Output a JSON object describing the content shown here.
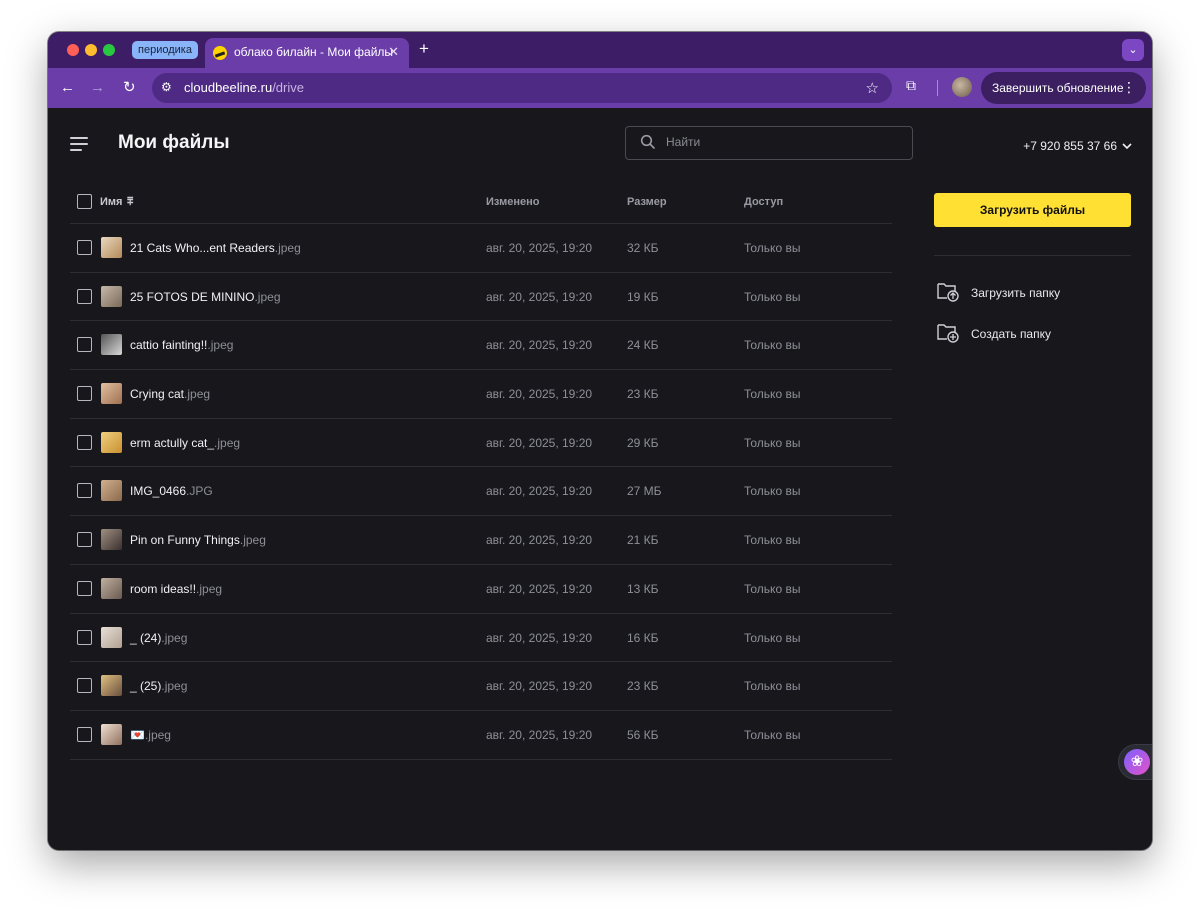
{
  "browser": {
    "tab_group_label": "периодика",
    "active_tab_title": "облако билайн - Мои файлы",
    "tab_close_glyph": "✕",
    "new_tab_glyph": "+",
    "tab_search_glyph": "⌄",
    "nav_back_glyph": "←",
    "nav_forward_glyph": "→",
    "nav_reload_glyph": "↻",
    "url_domain": "cloudbeeline.ru",
    "url_path": "/drive",
    "bookmark_glyph": "☆",
    "extensions_glyph": "⧉",
    "update_button_label": "Завершить обновление",
    "menu_glyph": "⋮"
  },
  "header": {
    "title": "Мои файлы",
    "search_placeholder": "Найти",
    "account_phone": "+7 920 855 37 66"
  },
  "table": {
    "columns": {
      "name": "Имя",
      "modified": "Изменено",
      "size": "Размер",
      "access": "Доступ"
    },
    "sort_glyph": "⩱",
    "rows": [
      {
        "base": "21 Cats Who...ent Readers",
        "ext": ".jpeg",
        "modified": "авг. 20, 2025, 19:20",
        "size": "32 КБ",
        "access": "Только вы"
      },
      {
        "base": "25 FOTOS DE MININO",
        "ext": ".jpeg",
        "modified": "авг. 20, 2025, 19:20",
        "size": "19 КБ",
        "access": "Только вы"
      },
      {
        "base": "cattio fainting!!",
        "ext": ".jpeg",
        "modified": "авг. 20, 2025, 19:20",
        "size": "24 КБ",
        "access": "Только вы"
      },
      {
        "base": "Crying cat",
        "ext": ".jpeg",
        "modified": "авг. 20, 2025, 19:20",
        "size": "23 КБ",
        "access": "Только вы"
      },
      {
        "base": "erm actully cat_",
        "ext": ".jpeg",
        "modified": "авг. 20, 2025, 19:20",
        "size": "29 КБ",
        "access": "Только вы"
      },
      {
        "base": "IMG_0466",
        "ext": ".JPG",
        "modified": "авг. 20, 2025, 19:20",
        "size": "27 МБ",
        "access": "Только вы"
      },
      {
        "base": "Pin on Funny Things",
        "ext": ".jpeg",
        "modified": "авг. 20, 2025, 19:20",
        "size": "21 КБ",
        "access": "Только вы"
      },
      {
        "base": "room ideas!!",
        "ext": ".jpeg",
        "modified": "авг. 20, 2025, 19:20",
        "size": "13 КБ",
        "access": "Только вы"
      },
      {
        "base": "_ (24)",
        "ext": ".jpeg",
        "modified": "авг. 20, 2025, 19:20",
        "size": "16 КБ",
        "access": "Только вы"
      },
      {
        "base": "_ (25)",
        "ext": ".jpeg",
        "modified": "авг. 20, 2025, 19:20",
        "size": "23 КБ",
        "access": "Только вы"
      },
      {
        "base": "💌",
        "ext": ".jpeg",
        "modified": "авг. 20, 2025, 19:20",
        "size": "56 КБ",
        "access": "Только вы"
      }
    ]
  },
  "sidebar": {
    "upload_files_label": "Загрузить файлы",
    "upload_folder_label": "Загрузить папку",
    "create_folder_label": "Создать папку",
    "assistant_glyph": "❀"
  },
  "colors": {
    "tab_strip": "#3d1d65",
    "toolbar": "#6a3da8",
    "page_background": "#17171c",
    "primary_button": "#ffe033"
  }
}
